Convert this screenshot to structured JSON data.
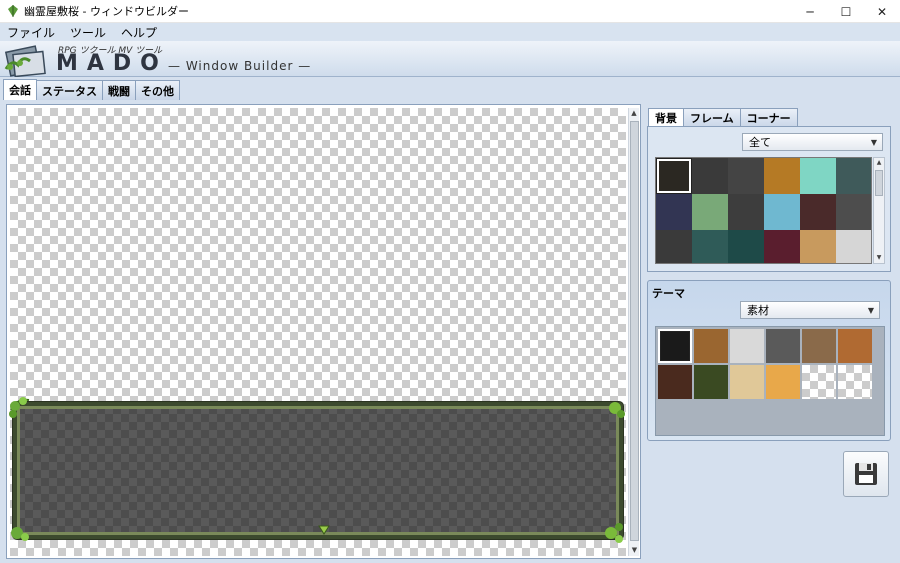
{
  "window": {
    "title": "幽霊屋敷桜 - ウィンドウビルダー",
    "minimize_glyph": "─",
    "maximize_glyph": "☐",
    "close_glyph": "✕"
  },
  "menu": [
    "ファイル",
    "ツール",
    "ヘルプ"
  ],
  "banner": {
    "subtitle": "RPG ツクール MV ツール",
    "logo_text": "MADO",
    "product": "— Window Builder —"
  },
  "main_tabs": [
    "会話",
    "ステータス",
    "戦闘",
    "その他"
  ],
  "right_tabs": [
    "背景",
    "フレーム",
    "コーナー"
  ],
  "background_panel": {
    "filter": "全て",
    "swatches": [
      "#2b2822",
      "#3a3a3a",
      "#444444",
      "#b57a25",
      "#7fd6c4",
      "#3f5a5a",
      "#323553",
      "#79a978",
      "#3d3d3d",
      "#6fb8d0",
      "#4a2a2a",
      "#4d4d4d",
      "#3a3a3a",
      "#2f5b58",
      "#1e4a48",
      "#5a1e2e",
      "#c89a5e",
      "#d6d6d6"
    ]
  },
  "theme_panel": {
    "label": "テーマ",
    "filter": "素材",
    "tiles": [
      "#1a1a1a",
      "#9a6630",
      "#d9d9d9",
      "#5a5a5a",
      "#8a6a4a",
      "#b06a32",
      "#4a2a1e",
      "#3a4a22",
      "#e0c898",
      "#e8a84a"
    ]
  },
  "scroll": {
    "up": "▲",
    "down": "▼"
  },
  "colors": {
    "accent": "#8aa0bc",
    "panel_bg": "#d5e0ee",
    "message_frame": "#3c4a2e"
  }
}
